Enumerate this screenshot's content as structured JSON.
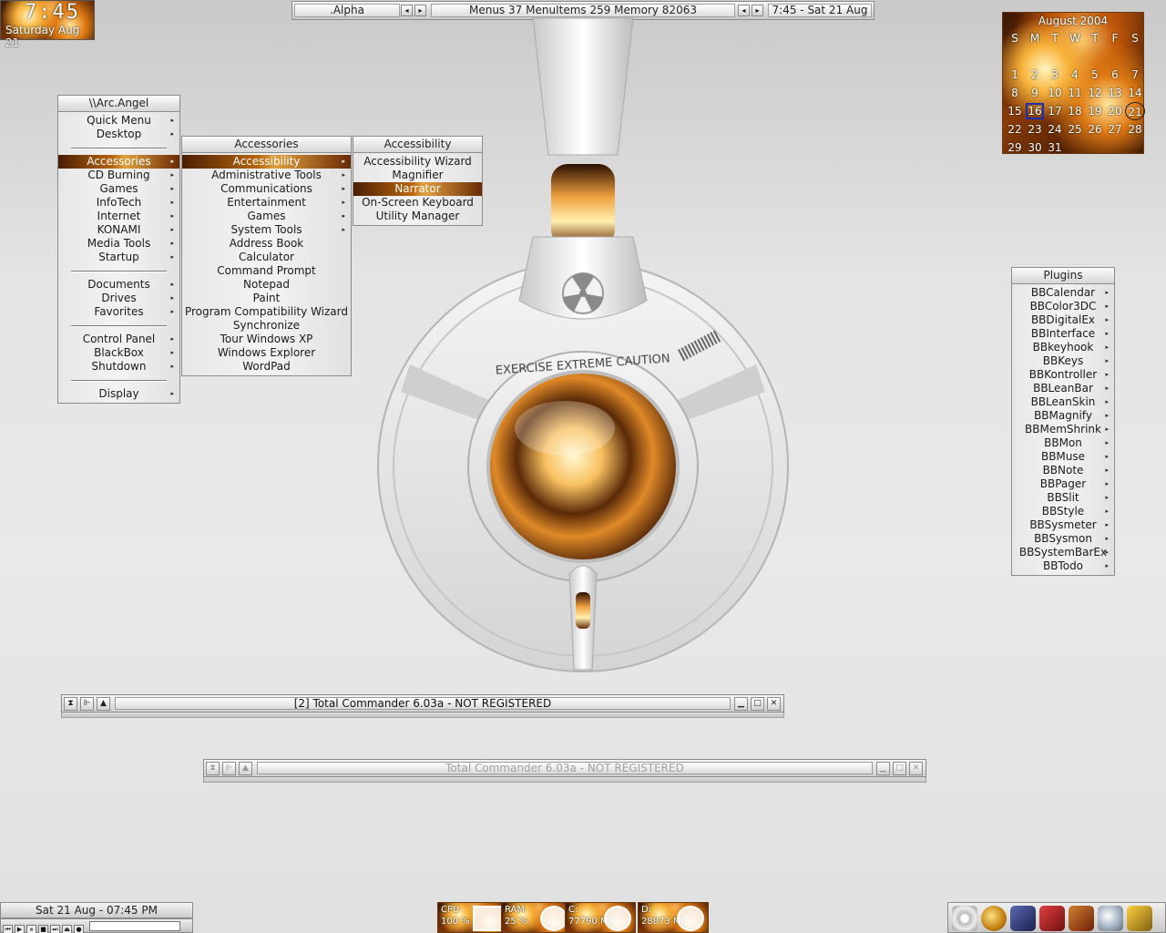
{
  "clock": {
    "time": "7:45",
    "date": "Saturday Aug 21"
  },
  "toolbar": {
    "workspace": ".Alpha",
    "stats": "Menus 37  MenuItems 259  Memory 82063",
    "datetime": "7:45 - Sat 21 Aug",
    "prev_icon": "arrow-left-icon",
    "next_icon": "arrow-right-icon"
  },
  "root_menu": {
    "title": "\\\\Arc.Angel",
    "items": [
      {
        "label": "Quick Menu",
        "submenu": true
      },
      {
        "label": "Desktop",
        "submenu": true
      },
      {
        "separator": true
      },
      {
        "label": "Accessories",
        "submenu": true,
        "selected": true
      },
      {
        "label": "CD Burning",
        "submenu": true
      },
      {
        "label": "Games",
        "submenu": true
      },
      {
        "label": "InfoTech",
        "submenu": true
      },
      {
        "label": "Internet",
        "submenu": true
      },
      {
        "label": "KONAMI",
        "submenu": true
      },
      {
        "label": "Media Tools",
        "submenu": true
      },
      {
        "label": "Startup",
        "submenu": true
      },
      {
        "separator": true
      },
      {
        "label": "Documents",
        "submenu": true
      },
      {
        "label": "Drives",
        "submenu": true
      },
      {
        "label": "Favorites",
        "submenu": true
      },
      {
        "separator": true
      },
      {
        "label": "Control Panel",
        "submenu": true
      },
      {
        "label": "BlackBox",
        "submenu": true
      },
      {
        "label": "Shutdown",
        "submenu": true
      },
      {
        "separator": true
      },
      {
        "label": "Display",
        "submenu": true
      }
    ]
  },
  "accessories_menu": {
    "title": "Accessories",
    "items": [
      {
        "label": "Accessibility",
        "submenu": true,
        "selected": true
      },
      {
        "label": "Administrative Tools",
        "submenu": true
      },
      {
        "label": "Communications",
        "submenu": true
      },
      {
        "label": "Entertainment",
        "submenu": true
      },
      {
        "label": "Games",
        "submenu": true
      },
      {
        "label": "System Tools",
        "submenu": true
      },
      {
        "label": "Address Book"
      },
      {
        "label": "Calculator"
      },
      {
        "label": "Command Prompt"
      },
      {
        "label": "Notepad"
      },
      {
        "label": "Paint"
      },
      {
        "label": "Program Compatibility Wizard"
      },
      {
        "label": "Synchronize"
      },
      {
        "label": "Tour Windows XP"
      },
      {
        "label": "Windows Explorer"
      },
      {
        "label": "WordPad"
      }
    ]
  },
  "accessibility_menu": {
    "title": "Accessibility",
    "items": [
      {
        "label": "Accessibility Wizard"
      },
      {
        "label": "Magnifier"
      },
      {
        "label": "Narrator",
        "selected": true
      },
      {
        "label": "On-Screen Keyboard"
      },
      {
        "label": "Utility Manager"
      }
    ]
  },
  "plugins_menu": {
    "title": "Plugins",
    "items": [
      "BBCalendar",
      "BBColor3DC",
      "BBDigitalEx",
      "BBInterface",
      "BBkeyhook",
      "BBKeys",
      "BBKontroller",
      "BBLeanBar",
      "BBLeanSkin",
      "BBMagnify",
      "BBMemShrink",
      "BBMon",
      "BBMuse",
      "BBNote",
      "BBPager",
      "BBSlit",
      "BBStyle",
      "BBSysmeter",
      "BBSysmon",
      "BBSystemBarEx",
      "BBTodo"
    ]
  },
  "calendar": {
    "title": "August 2004",
    "weekdays": [
      "S",
      "M",
      "T",
      "W",
      "T",
      "F",
      "S"
    ],
    "weeks": [
      [
        "",
        "",
        "",
        "",
        "",
        "",
        ""
      ],
      [
        "1",
        "2",
        "3",
        "4",
        "5",
        "6",
        "7"
      ],
      [
        "8",
        "9",
        "10",
        "11",
        "12",
        "13",
        "14"
      ],
      [
        "15",
        "16",
        "17",
        "18",
        "19",
        "20",
        "21"
      ],
      [
        "22",
        "23",
        "24",
        "25",
        "26",
        "27",
        "28"
      ],
      [
        "29",
        "30",
        "31",
        "",
        "",
        "",
        ""
      ]
    ],
    "today": "21",
    "highlighted": "16"
  },
  "artwork": {
    "caution_text": "EXERCISE EXTREME CAUTION"
  },
  "windows": [
    {
      "title": "[2] Total Commander 6.03a - NOT REGISTERED",
      "active": true
    },
    {
      "title": "Total Commander 6.03a - NOT REGISTERED",
      "active": false
    }
  ],
  "bottom": {
    "datetime": "Sat 21 Aug - 07:45 PM",
    "monitors": [
      {
        "label": "CPU",
        "value": "100 %",
        "level": 1.0
      },
      {
        "label": "RAM",
        "value": "25 %",
        "level": 0.25
      },
      {
        "label": "C:",
        "value": "77790 MB",
        "level": 0.5
      },
      {
        "label": "D:",
        "value": "28873 MB",
        "level": 0.5
      }
    ],
    "tray_icons": [
      "disc-icon",
      "ball-icon",
      "folder-icon",
      "book-icon",
      "book-red-icon",
      "magnifier-icon",
      "flag-icon"
    ]
  },
  "colors": {
    "selected_gradient_mid": "#b8660f",
    "fire": "#e07b14"
  }
}
